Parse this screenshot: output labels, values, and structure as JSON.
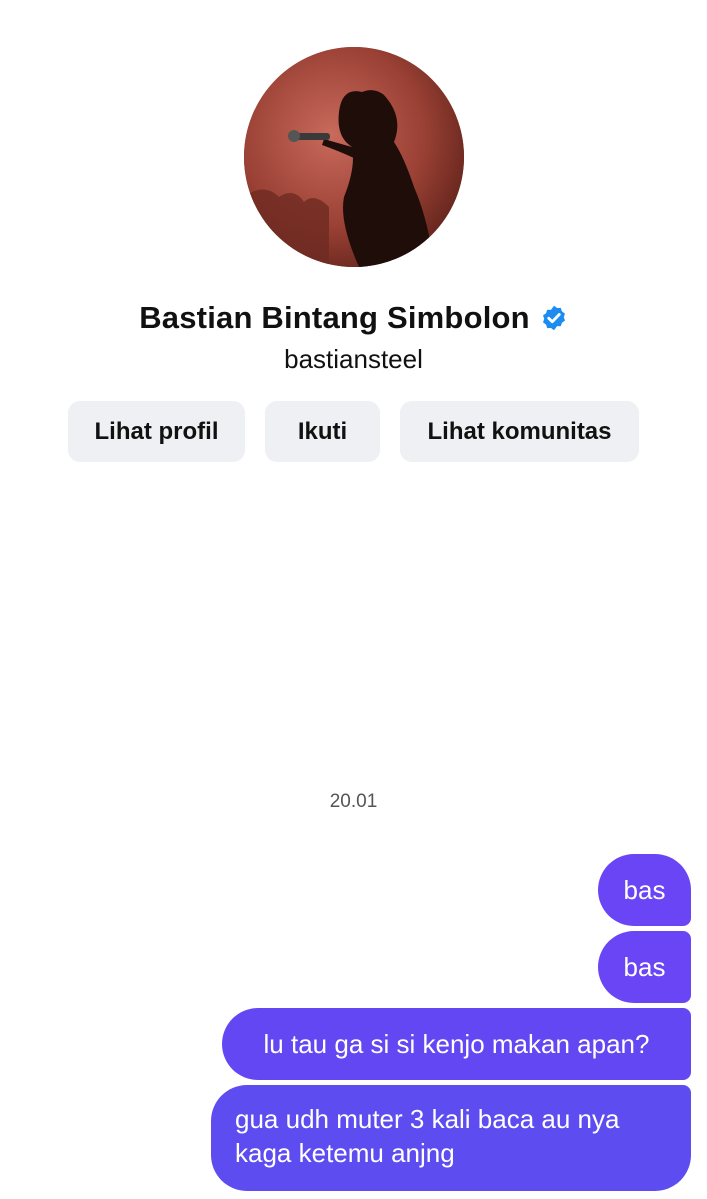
{
  "profile": {
    "name": "Bastian Bintang Simbolon",
    "handle": "bastiansteel",
    "verified": true
  },
  "actions": {
    "view_profile": "Lihat profil",
    "follow": "Ikuti",
    "view_community": "Lihat komunitas"
  },
  "chat": {
    "timestamp": "20.01",
    "messages": [
      {
        "text": "bas"
      },
      {
        "text": "bas"
      },
      {
        "text": "lu tau ga si si kenjo makan apan?"
      },
      {
        "text": "gua udh muter 3 kali baca au nya kaga ketemu anjng"
      }
    ]
  },
  "colors": {
    "bubble": "#6a45f5",
    "button_bg": "#eef0f3",
    "verified_badge": "#1d8cf0"
  }
}
